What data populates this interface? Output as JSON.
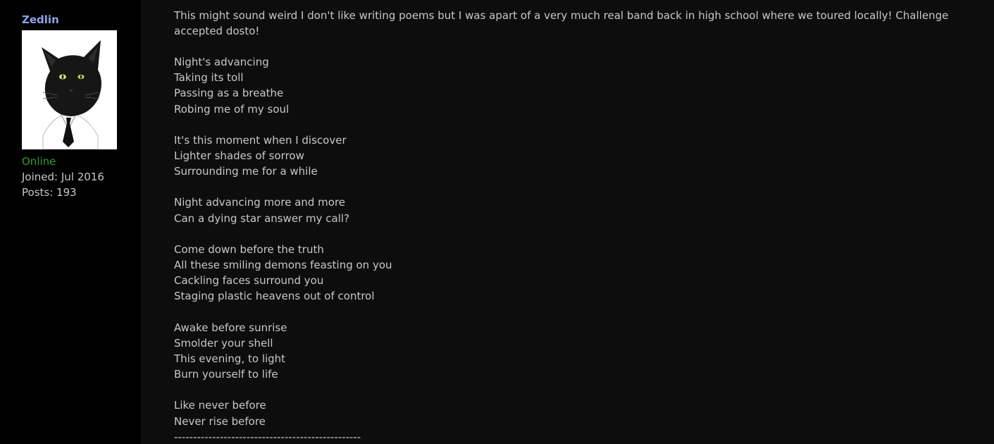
{
  "author": {
    "username": "Zedlin",
    "avatar_icon": "black-cat-in-suit-icon",
    "status": "Online",
    "joined": "Joined: Jul 2016",
    "posts": "Posts: 193"
  },
  "post": {
    "intro": "This might sound weird I don't like writing poems but I was apart of a very much real band back in high school where we toured locally! Challenge accepted dosto!",
    "stanzas": [
      [
        "Night's advancing",
        "Taking its toll",
        "Passing as a breathe",
        "Robing me of my soul"
      ],
      [
        "It's this moment when I discover",
        "Lighter shades of sorrow",
        "Surrounding me for a while"
      ],
      [
        "Night advancing more and more",
        "Can a dying star answer my call?"
      ],
      [
        "Come down before the truth",
        "All these smiling demons feasting on you",
        "Cackling faces surround you",
        "Staging plastic heavens out of control"
      ],
      [
        "Awake before sunrise",
        "Smolder your shell",
        "This evening, to light",
        "Burn yourself to life"
      ],
      [
        "Like never before",
        "Never rise before"
      ]
    ],
    "divider": "-------------------------------------------------"
  },
  "colors": {
    "username": "#8fa3e6",
    "online": "#2e9e2e",
    "text": "#c8c8c8",
    "sidebar_bg": "#000000",
    "post_bg": "#0d0d0d"
  }
}
